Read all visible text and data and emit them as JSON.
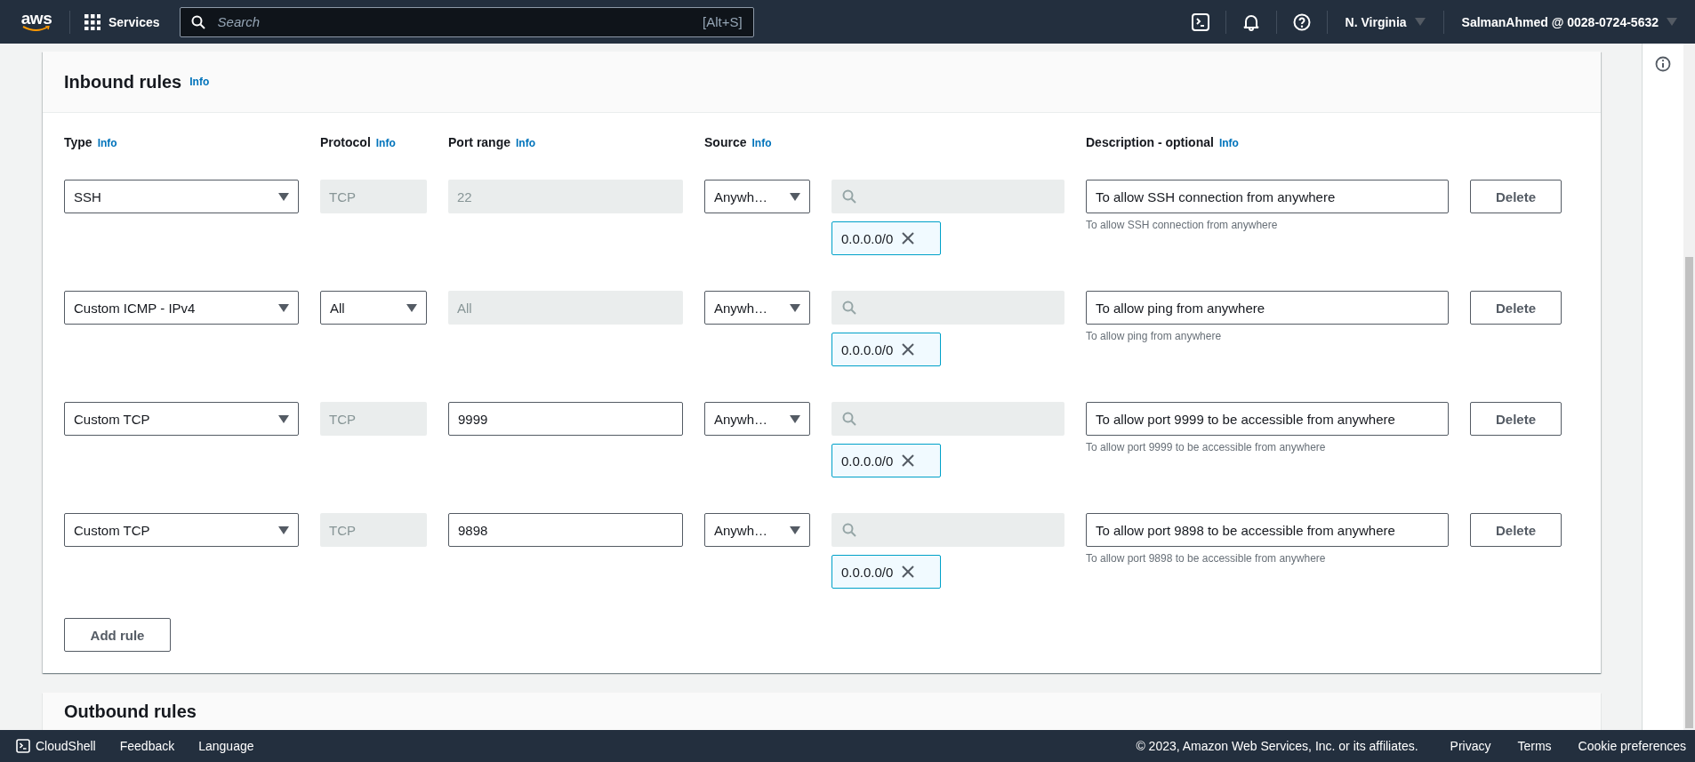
{
  "top_bar": {
    "logo": "aws",
    "services": "Services",
    "search": {
      "placeholder": "Search",
      "shortcut": "[Alt+S]"
    },
    "region": "N. Virginia",
    "account": "SalmanAhmed @ 0028-0724-5632"
  },
  "inbound": {
    "title": "Inbound rules",
    "info": "Info",
    "columns": [
      {
        "label": "Type",
        "info": "Info"
      },
      {
        "label": "Protocol",
        "info": "Info"
      },
      {
        "label": "Port range",
        "info": "Info"
      },
      {
        "label": "Source",
        "info": "Info"
      },
      {
        "label": "Description - optional",
        "info": "Info"
      }
    ],
    "rules": [
      {
        "type": "SSH",
        "protocol": "TCP",
        "protocol_disabled": true,
        "port_range": "22",
        "port_disabled": true,
        "source": "Anywh…",
        "cidr": "0.0.0.0/0",
        "description": "To allow SSH connection from anywhere",
        "hint": "To allow SSH connection from anywhere",
        "delete": "Delete"
      },
      {
        "type": "Custom ICMP - IPv4",
        "protocol": "All",
        "protocol_disabled": false,
        "port_range": "All",
        "port_disabled": true,
        "source": "Anywh…",
        "cidr": "0.0.0.0/0",
        "description": "To allow ping from anywhere",
        "hint": "To allow ping from anywhere",
        "delete": "Delete"
      },
      {
        "type": "Custom TCP",
        "protocol": "TCP",
        "protocol_disabled": true,
        "port_range": "9999",
        "port_disabled": false,
        "source": "Anywh…",
        "cidr": "0.0.0.0/0",
        "description": "To allow port 9999 to be accessible from anywhere",
        "hint": "To allow port 9999 to be accessible from anywhere",
        "delete": "Delete"
      },
      {
        "type": "Custom TCP",
        "protocol": "TCP",
        "protocol_disabled": true,
        "port_range": "9898",
        "port_disabled": false,
        "source": "Anywh…",
        "cidr": "0.0.0.0/0",
        "description": "To allow port 9898 to be accessible from anywhere",
        "hint": "To allow port 9898 to be accessible from anywhere",
        "delete": "Delete"
      }
    ],
    "add_rule": "Add rule"
  },
  "outbound": {
    "title": "Outbound rules"
  },
  "footer": {
    "left": [
      "CloudShell",
      "Feedback",
      "Language"
    ],
    "copyright": "© 2023, Amazon Web Services, Inc. or its affiliates.",
    "links": [
      "Privacy",
      "Terms",
      "Cookie preferences"
    ]
  }
}
